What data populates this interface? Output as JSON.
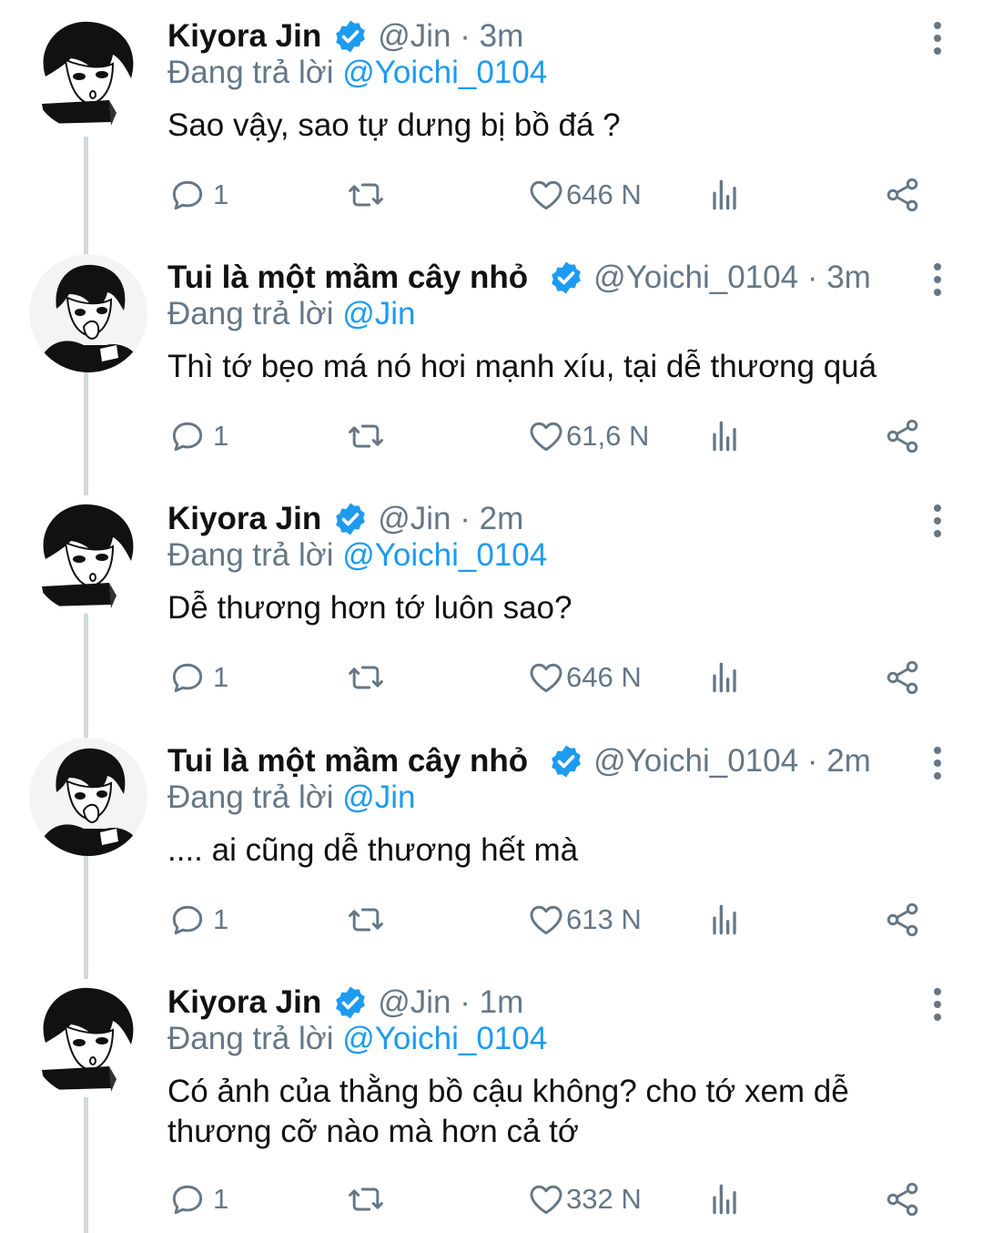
{
  "tweets": [
    {
      "name": "Kiyora Jin",
      "handle": "@Jin",
      "time": "· 3m",
      "replying_prefix": "Đang trả lời",
      "replying_to": "@Yoichi_0104",
      "text": "Sao vậy, sao tự dưng bị bồ đá ?",
      "replies": "1",
      "likes": "646 N",
      "avatar": "avatar-jin"
    },
    {
      "name": "Tui là một mầm cây nhỏ",
      "handle": "@Yoichi_0104",
      "time": "· 3m",
      "replying_prefix": "Đang trả lời",
      "replying_to": "@Jin",
      "text": "Thì tớ bẹo má nó hơi mạnh xíu, tại dễ thương quá",
      "replies": "1",
      "likes": "61,6 N",
      "avatar": "avatar-yoichi"
    },
    {
      "name": "Kiyora Jin",
      "handle": "@Jin",
      "time": "· 2m",
      "replying_prefix": "Đang trả lời",
      "replying_to": "@Yoichi_0104",
      "text": "Dễ thương hơn tớ luôn sao?",
      "replies": "1",
      "likes": "646 N",
      "avatar": "avatar-jin"
    },
    {
      "name": "Tui là một mầm cây nhỏ",
      "handle": "@Yoichi_0104",
      "time": "· 2m",
      "replying_prefix": "Đang trả lời",
      "replying_to": "@Jin",
      "text": ".... ai cũng dễ thương hết mà",
      "replies": "1",
      "likes": "613 N",
      "avatar": "avatar-yoichi"
    },
    {
      "name": "Kiyora Jin",
      "handle": "@Jin",
      "time": "· 1m",
      "replying_prefix": "Đang trả lời",
      "replying_to": "@Yoichi_0104",
      "text": "Có ảnh của thằng bồ cậu không? cho tớ xem dễ thương cỡ nào mà hơn cả tớ",
      "replies": "1",
      "likes": "332 N",
      "avatar": "avatar-jin"
    }
  ],
  "icons": {
    "reply": "reply-icon",
    "retweet": "retweet-icon",
    "like": "heart-icon",
    "views": "views-icon",
    "share": "share-icon",
    "more": "more-vertical-icon",
    "verified": "verified-badge-icon"
  },
  "colors": {
    "accent": "#1d9bf0",
    "muted": "#657786",
    "thread_line": "#cfd9de"
  }
}
